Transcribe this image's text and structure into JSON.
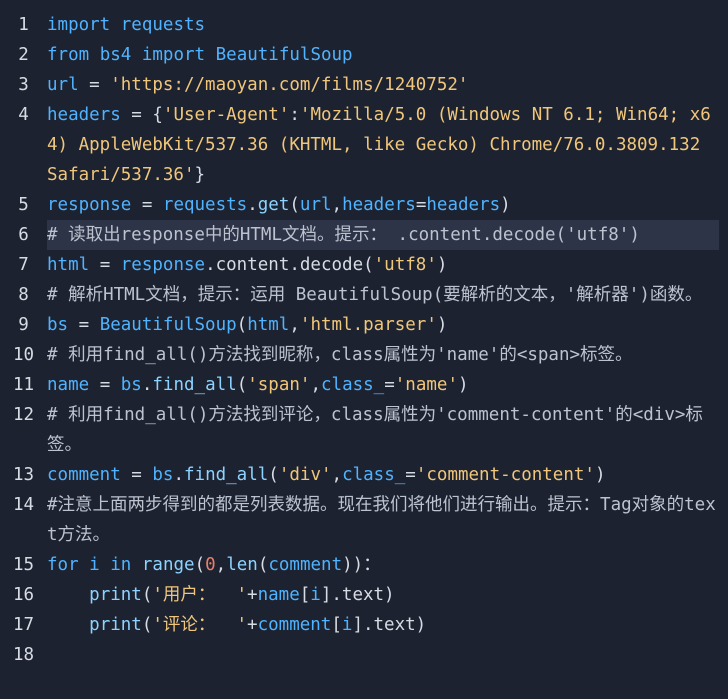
{
  "editor": {
    "lines": [
      {
        "num": "1",
        "tokens": [
          [
            "kw",
            "import"
          ],
          [
            "pl",
            " "
          ],
          [
            "id",
            "requests"
          ]
        ]
      },
      {
        "num": "2",
        "tokens": [
          [
            "kw",
            "from"
          ],
          [
            "pl",
            " "
          ],
          [
            "id",
            "bs4"
          ],
          [
            "pl",
            " "
          ],
          [
            "kw",
            "import"
          ],
          [
            "pl",
            " "
          ],
          [
            "id",
            "BeautifulSoup"
          ]
        ]
      },
      {
        "num": "3",
        "tokens": [
          [
            "id",
            "url"
          ],
          [
            "pl",
            " = "
          ],
          [
            "str",
            "'https://maoyan.com/films/1240752'"
          ]
        ]
      },
      {
        "num": "4",
        "tokens": [
          [
            "id",
            "headers"
          ],
          [
            "pl",
            " = {"
          ],
          [
            "str",
            "'User-Agent'"
          ],
          [
            "pl",
            ":"
          ],
          [
            "str",
            "'Mozilla/5.0 (Windows NT 6.1; Win64; x64) AppleWebKit/537.36 (KHTML, like Gecko) Chrome/76.0.3809.132 Safari/537.36'"
          ],
          [
            "pl",
            "}"
          ]
        ]
      },
      {
        "num": "5",
        "tokens": [
          [
            "id",
            "response"
          ],
          [
            "pl",
            " = "
          ],
          [
            "id",
            "requests"
          ],
          [
            "pl",
            "."
          ],
          [
            "fn",
            "get"
          ],
          [
            "pl",
            "("
          ],
          [
            "id",
            "url"
          ],
          [
            "pl",
            ","
          ],
          [
            "id",
            "headers"
          ],
          [
            "pl",
            "="
          ],
          [
            "id",
            "headers"
          ],
          [
            "pl",
            ")"
          ]
        ]
      },
      {
        "num": "6",
        "highlight": true,
        "tokens": [
          [
            "cm",
            "# 读取出response中的HTML文档。提示： .content.decode('utf8')"
          ]
        ]
      },
      {
        "num": "7",
        "tokens": [
          [
            "id",
            "html"
          ],
          [
            "pl",
            " = "
          ],
          [
            "id",
            "response"
          ],
          [
            "pl",
            ".content.decode("
          ],
          [
            "str",
            "'utf8'"
          ],
          [
            "pl",
            ")"
          ]
        ]
      },
      {
        "num": "8",
        "tokens": [
          [
            "cm",
            "# 解析HTML文档，提示：运用 BeautifulSoup(要解析的文本，'解析器')函数。"
          ]
        ]
      },
      {
        "num": "9",
        "tokens": [
          [
            "id",
            "bs"
          ],
          [
            "pl",
            " = "
          ],
          [
            "id",
            "BeautifulSoup"
          ],
          [
            "pl",
            "("
          ],
          [
            "id",
            "html"
          ],
          [
            "pl",
            ","
          ],
          [
            "str",
            "'html.parser'"
          ],
          [
            "pl",
            ")"
          ]
        ]
      },
      {
        "num": "10",
        "tokens": [
          [
            "cm",
            "# 利用find_all()方法找到昵称，class属性为'name'的<span>标签。"
          ]
        ]
      },
      {
        "num": "11",
        "tokens": [
          [
            "id",
            "name"
          ],
          [
            "pl",
            " = "
          ],
          [
            "id",
            "bs"
          ],
          [
            "pl",
            "."
          ],
          [
            "fn",
            "find_all"
          ],
          [
            "pl",
            "("
          ],
          [
            "str",
            "'span'"
          ],
          [
            "pl",
            ","
          ],
          [
            "id",
            "class_"
          ],
          [
            "pl",
            "="
          ],
          [
            "str",
            "'name'"
          ],
          [
            "pl",
            ")"
          ]
        ]
      },
      {
        "num": "12",
        "tokens": [
          [
            "cm",
            "# 利用find_all()方法找到评论，class属性为'comment-content'的<div>标签。"
          ]
        ]
      },
      {
        "num": "13",
        "tokens": [
          [
            "id",
            "comment"
          ],
          [
            "pl",
            " = "
          ],
          [
            "id",
            "bs"
          ],
          [
            "pl",
            "."
          ],
          [
            "fn",
            "find_all"
          ],
          [
            "pl",
            "("
          ],
          [
            "str",
            "'div'"
          ],
          [
            "pl",
            ","
          ],
          [
            "id",
            "class_"
          ],
          [
            "pl",
            "="
          ],
          [
            "str",
            "'comment-content'"
          ],
          [
            "pl",
            ")"
          ]
        ]
      },
      {
        "num": "14",
        "tokens": [
          [
            "cm",
            "#注意上面两步得到的都是列表数据。现在我们将他们进行输出。提示：Tag对象的text方法。"
          ]
        ]
      },
      {
        "num": "15",
        "tokens": [
          [
            "kw",
            "for"
          ],
          [
            "pl",
            " "
          ],
          [
            "id",
            "i"
          ],
          [
            "pl",
            " "
          ],
          [
            "kw",
            "in"
          ],
          [
            "pl",
            " "
          ],
          [
            "fn",
            "range"
          ],
          [
            "pl",
            "("
          ],
          [
            "num",
            "0"
          ],
          [
            "pl",
            ","
          ],
          [
            "fn",
            "len"
          ],
          [
            "pl",
            "("
          ],
          [
            "id",
            "comment"
          ],
          [
            "pl",
            "))："
          ]
        ]
      },
      {
        "num": "16",
        "tokens": [
          [
            "pl",
            "    "
          ],
          [
            "fn",
            "print"
          ],
          [
            "pl",
            "("
          ],
          [
            "str",
            "'用户：  '"
          ],
          [
            "pl",
            "+"
          ],
          [
            "id",
            "name"
          ],
          [
            "pl",
            "["
          ],
          [
            "id",
            "i"
          ],
          [
            "pl",
            "].text)"
          ]
        ]
      },
      {
        "num": "17",
        "tokens": [
          [
            "pl",
            "    "
          ],
          [
            "fn",
            "print"
          ],
          [
            "pl",
            "("
          ],
          [
            "str",
            "'评论：  '"
          ],
          [
            "pl",
            "+"
          ],
          [
            "id",
            "comment"
          ],
          [
            "pl",
            "["
          ],
          [
            "id",
            "i"
          ],
          [
            "pl",
            "].text)"
          ]
        ]
      },
      {
        "num": "18",
        "tokens": []
      }
    ]
  }
}
